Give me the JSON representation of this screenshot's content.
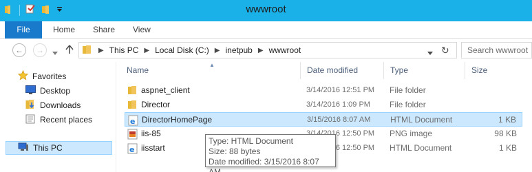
{
  "window": {
    "title": "wwwroot"
  },
  "ribbon": {
    "tabs": [
      {
        "label": "File"
      },
      {
        "label": "Home"
      },
      {
        "label": "Share"
      },
      {
        "label": "View"
      }
    ]
  },
  "address": {
    "crumbs": [
      "This PC",
      "Local Disk (C:)",
      "inetpub",
      "wwwroot"
    ],
    "search_placeholder": "Search wwwroot"
  },
  "nav": {
    "favorites_label": "Favorites",
    "items": [
      {
        "label": "Desktop"
      },
      {
        "label": "Downloads"
      },
      {
        "label": "Recent places"
      }
    ],
    "this_pc_label": "This PC"
  },
  "columns": {
    "name": "Name",
    "date": "Date modified",
    "type": "Type",
    "size": "Size"
  },
  "files": [
    {
      "name": "aspnet_client",
      "date": "3/14/2016 12:51 PM",
      "type": "File folder",
      "size": "",
      "icon": "folder-icon"
    },
    {
      "name": "Director",
      "date": "3/14/2016 1:09 PM",
      "type": "File folder",
      "size": "",
      "icon": "folder-icon"
    },
    {
      "name": "DirectorHomePage",
      "date": "3/15/2016 8:07 AM",
      "type": "HTML Document",
      "size": "1 KB",
      "icon": "ie-document-icon",
      "selected": true
    },
    {
      "name": "iis-85",
      "date": "3/14/2016 12:50 PM",
      "type": "PNG image",
      "size": "98 KB",
      "icon": "png-image-icon"
    },
    {
      "name": "iisstart",
      "date": "3/14/2016 12:50 PM",
      "type": "HTML Document",
      "size": "1 KB",
      "icon": "ie-document-icon"
    }
  ],
  "tooltip": {
    "type_line": "Type: HTML Document",
    "size_line": "Size: 88 bytes",
    "date_line": "Date modified: 3/15/2016 8:07 AM"
  },
  "colors": {
    "titlebar": "#1ab1e8",
    "file_tab": "#1979ca",
    "selection": "#cce8ff",
    "folder": "#f2c55c"
  }
}
